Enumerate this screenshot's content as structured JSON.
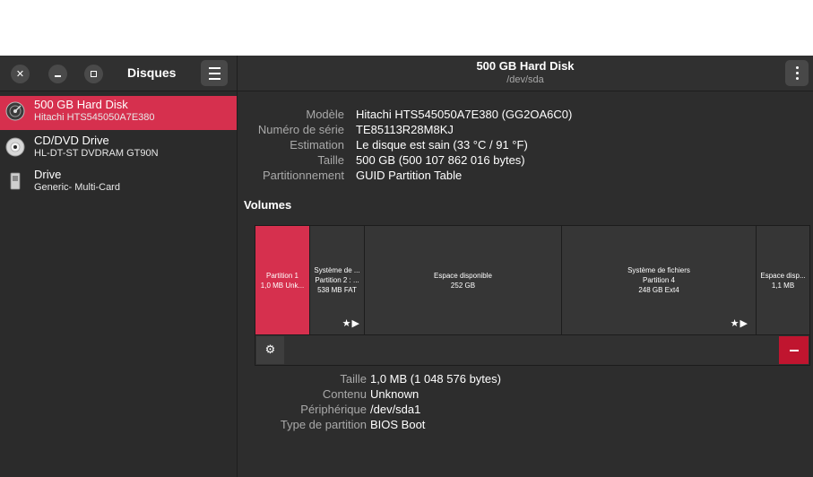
{
  "sidebar_header": {
    "title": "Disques"
  },
  "header": {
    "title": "500 GB Hard Disk",
    "subtitle": "/dev/sda"
  },
  "drives": [
    {
      "name": "500 GB Hard Disk",
      "model": "Hitachi HTS545050A7E380",
      "icon": "hard-disk-icon"
    },
    {
      "name": "CD/DVD Drive",
      "model": "HL-DT-ST DVDRAM GT90N",
      "icon": "optical-disc-icon"
    },
    {
      "name": "Drive",
      "model": "Generic- Multi-Card",
      "icon": "usb-drive-icon"
    }
  ],
  "disk_info": [
    {
      "label": "Modèle",
      "value": "Hitachi HTS545050A7E380 (GG2OA6C0)"
    },
    {
      "label": "Numéro de série",
      "value": "TE85113R28M8KJ"
    },
    {
      "label": "Estimation",
      "value": "Le disque est sain (33 °C / 91 °F)"
    },
    {
      "label": "Taille",
      "value": "500 GB (500 107 862 016 bytes)"
    },
    {
      "label": "Partitionnement",
      "value": "GUID Partition Table"
    }
  ],
  "volumes_heading": "Volumes",
  "segments": [
    {
      "line1": "Partition 1",
      "line2": "1,0 MB Unk...",
      "line3": ""
    },
    {
      "line1": "Système de ...",
      "line2": "Partition 2 : ...",
      "line3": "538 MB FAT"
    },
    {
      "line1": "Espace disponible",
      "line2": "252 GB",
      "line3": ""
    },
    {
      "line1": "Système de fichiers",
      "line2": "Partition 4",
      "line3": "248 GB Ext4"
    },
    {
      "line1": "Espace disp...",
      "line2": "1,1 MB",
      "line3": ""
    }
  ],
  "segment_marks": "★▶",
  "partition_info": [
    {
      "label": "Taille",
      "value": "1,0 MB (1 048 576 bytes)"
    },
    {
      "label": "Contenu",
      "value": "Unknown"
    },
    {
      "label": "Périphérique",
      "value": "/dev/sda1"
    },
    {
      "label": "Type de partition",
      "value": "BIOS Boot"
    }
  ],
  "colors": {
    "accent": "#d6304e",
    "danger": "#c0152f",
    "background": "#2d2d2d"
  }
}
